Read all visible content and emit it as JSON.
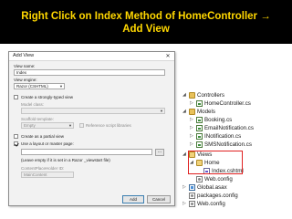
{
  "banner": {
    "line1": "Right Click on Index Method of HomeController →",
    "line2": "Add View"
  },
  "dialog": {
    "title": "Add View",
    "close_glyph": "✕",
    "view_name_label": "View name:",
    "view_name_value": "Index",
    "view_engine_label": "View engine:",
    "view_engine_value": "Razor (CSHTML)",
    "strongly_typed_label": "Create a strongly-typed view",
    "strongly_typed_checked": false,
    "model_class_label": "Model class:",
    "model_class_value": "",
    "scaffold_label": "Scaffold template:",
    "scaffold_value": "Empty",
    "reference_scripts_label": "Reference script libraries",
    "reference_scripts_checked": false,
    "partial_view_label": "Create as a partial view",
    "partial_view_checked": false,
    "layout_label": "Use a layout or master page:",
    "layout_checked": true,
    "layout_value": "",
    "browse_label": "...",
    "layout_hint": "(Leave empty if it is set in a Razor _viewstart file)",
    "placeholder_label": "ContentPlaceHolder ID:",
    "placeholder_value": "MainContent",
    "add_button": "Add",
    "cancel_button": "Cancel"
  },
  "explorer": {
    "nodes": [
      {
        "label": "Controllers",
        "icon": "folder-icon",
        "expander": "◢"
      },
      {
        "label": "HomeController.cs",
        "icon": "cs-file-icon",
        "expander": "▷"
      },
      {
        "label": "Models",
        "icon": "folder-icon",
        "expander": "◢"
      },
      {
        "label": "Booking.cs",
        "icon": "cs-file-icon",
        "expander": "▷"
      },
      {
        "label": "EmailNotification.cs",
        "icon": "cs-file-icon",
        "expander": "▷"
      },
      {
        "label": "INotification.cs",
        "icon": "cs-file-icon",
        "expander": "▷"
      },
      {
        "label": "SMSNotification.cs",
        "icon": "cs-file-icon",
        "expander": "▷"
      },
      {
        "label": "Views",
        "icon": "folder-icon",
        "expander": "◢"
      },
      {
        "label": "Home",
        "icon": "folder-icon",
        "expander": "◢"
      },
      {
        "label": "Index.cshtml",
        "icon": "cshtml-file-icon",
        "expander": ""
      },
      {
        "label": "Web.config",
        "icon": "config-file-icon",
        "expander": ""
      },
      {
        "label": "Global.asax",
        "icon": "asax-file-icon",
        "expander": "▷"
      },
      {
        "label": "packages.config",
        "icon": "config-file-icon",
        "expander": ""
      },
      {
        "label": "Web.config",
        "icon": "config-file-icon",
        "expander": "▷"
      }
    ]
  },
  "colors": {
    "banner_bg": "#000000",
    "banner_text": "#FFD700",
    "highlight": "#e02020"
  }
}
